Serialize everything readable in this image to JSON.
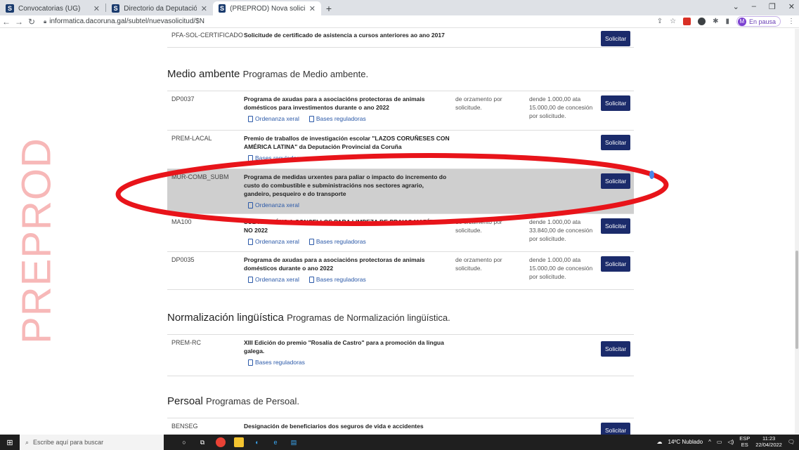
{
  "browser": {
    "tabs": [
      {
        "title": "Convocatorias (UG)",
        "favicon": "S"
      },
      {
        "title": "Directorio da Deputación",
        "favicon": "S"
      },
      {
        "title": "(PREPROD) Nova solicitude",
        "favicon": "S"
      }
    ],
    "new_tab": "+",
    "url": "informatica.dacoruna.gal/subtel/nuevasolicitud/$N",
    "profile_initial": "M",
    "profile_label": "En pausa"
  },
  "watermark": "PREPROD",
  "top_row": {
    "code": "PFA-SOL-CERTIFICADO",
    "desc": "Solicitude de certificado de asistencia a cursos anteriores ao ano 2017",
    "button": "Solicitar"
  },
  "sections": {
    "medio": {
      "title": "Medio ambente",
      "sub": "Programas de Medio ambente."
    },
    "normalizacion": {
      "title": "Normalización lingüística",
      "sub": "Programas de Normalización lingüística."
    },
    "persoal": {
      "title": "Persoal",
      "sub": "Programas de Persoal."
    }
  },
  "rows": {
    "r1": {
      "code": "DP0037",
      "desc": "Programa de axudas para a asociacións protectoras de animais domésticos para investimentos durante o ano 2022",
      "link1": "Ordenanza xeral",
      "link2": "Bases reguladoras",
      "budget": "de orzamento por solicitude.",
      "grant": "dende 1.000,00 ata 15.000,00 de concesión por solicitude.",
      "button": "Solicitar"
    },
    "r2": {
      "code": "PREM-LACAL",
      "desc": "Premio de traballos de investigación escolar \"LAZOS CORUÑESES CON AMÉRICA LATINA\" da Deputación Provincial da Coruña",
      "link2": "Bases reguladoras",
      "button": "Solicitar"
    },
    "r3": {
      "code": "MUR-COMB_SUBM",
      "desc": "Programa de medidas urxentes para paliar o impacto do incremento do custo do combustible e subministracións nos sectores agrario, gandeiro, pesqueiro e do transporte",
      "link1": "Ordenanza xeral",
      "button": "Solicitar"
    },
    "r4": {
      "code": "MA100",
      "desc": "SUBVENCIÓNS A CONCELLOS PARA LIMPEZA DE PRAIAS MARÍTIMAS NO 2022",
      "link1": "Ordenanza xeral",
      "link2": "Bases reguladoras",
      "budget": "de orzamento por solicitude.",
      "grant": "dende 1.000,00 ata 33.840,00 de concesión por solicitude.",
      "button": "Solicitar"
    },
    "r5": {
      "code": "DP0035",
      "desc": "Programa de axudas para a asociacións protectoras de animais domésticos durante o ano 2022",
      "link1": "Ordenanza xeral",
      "link2": "Bases reguladoras",
      "budget": "de orzamento por solicitude.",
      "grant": "dende 1.000,00 ata 15.000,00 de concesión por solicitude.",
      "button": "Solicitar"
    },
    "r6": {
      "code": "PREM-RC",
      "desc": "XIII Edición do premio \"Rosalía de Castro\" para a promoción da lingua galega.",
      "link2": "Bases reguladoras",
      "button": "Solicitar"
    },
    "r7": {
      "code": "BENSEG",
      "desc": "Designación de beneficiarios dos seguros de vida e accidentes",
      "button": "Solicitar"
    }
  },
  "taskbar": {
    "search_placeholder": "Escribe aquí para buscar",
    "weather": "14ºC Nublado",
    "lang1": "ESP",
    "lang2": "ES",
    "time": "11:23",
    "date": "22/04/2022"
  }
}
